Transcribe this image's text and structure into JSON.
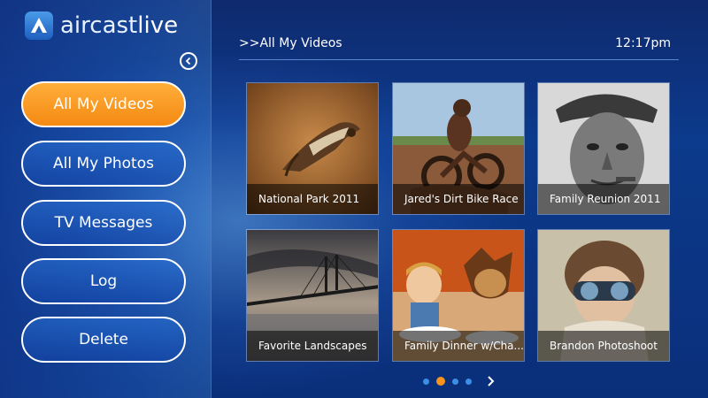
{
  "app": {
    "logo_brand": "aircast",
    "logo_live": "live"
  },
  "header": {
    "title": ">>All My Videos",
    "time": "12:17pm"
  },
  "sidebar": {
    "items": [
      {
        "label": "All My Videos",
        "active": true
      },
      {
        "label": "All My Photos",
        "active": false
      },
      {
        "label": "TV Messages",
        "active": false
      },
      {
        "label": "Log",
        "active": false
      },
      {
        "label": "Delete",
        "active": false
      }
    ]
  },
  "tiles": [
    {
      "label": "National Park 2011",
      "icon": "owl-photo"
    },
    {
      "label": "Jared's Dirt Bike Race",
      "icon": "dirt-bike-photo"
    },
    {
      "label": "Family Reunion 2011",
      "icon": "old-man-photo"
    },
    {
      "label": "Favorite Landscapes",
      "icon": "bridge-landscape-photo"
    },
    {
      "label": "Family Dinner w/Cha...",
      "icon": "boy-and-dog-photo"
    },
    {
      "label": "Brandon Photoshoot",
      "icon": "aviator-child-photo"
    }
  ],
  "pager": {
    "pages": 4,
    "current": 1
  },
  "colors": {
    "accent_orange": "#f7941d",
    "dot_blue": "#3d8fe6",
    "background": "#0c3a8c"
  }
}
